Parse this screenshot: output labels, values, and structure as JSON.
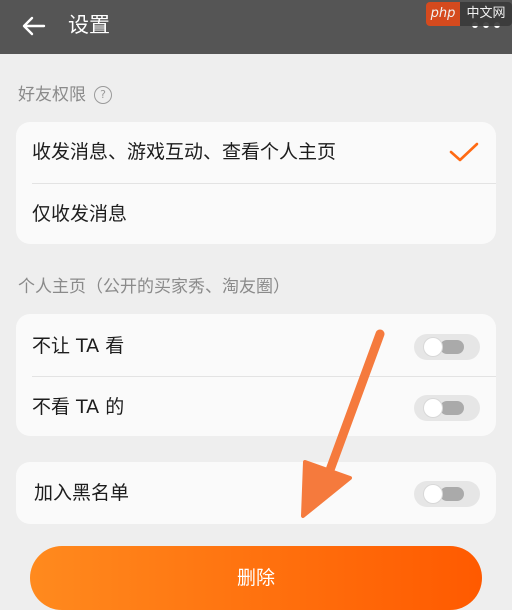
{
  "header": {
    "title": "设置"
  },
  "watermark": {
    "left": "php",
    "right": "中文网"
  },
  "friend_permissions": {
    "label": "好友权限",
    "help_glyph": "?",
    "options": [
      {
        "label": "收发消息、游戏互动、查看个人主页",
        "selected": true
      },
      {
        "label": "仅收发消息",
        "selected": false
      }
    ]
  },
  "profile_section": {
    "label": "个人主页（公开的买家秀、淘友圈）",
    "items": [
      {
        "label": "不让 TA 看",
        "enabled": false
      },
      {
        "label": "不看 TA 的",
        "enabled": false
      }
    ]
  },
  "blacklist": {
    "label": "加入黑名单",
    "enabled": false
  },
  "delete_button": {
    "label": "删除"
  },
  "colors": {
    "accent": "#ff6a13",
    "arrow": "#f57a3d",
    "topbar": "#555555"
  }
}
